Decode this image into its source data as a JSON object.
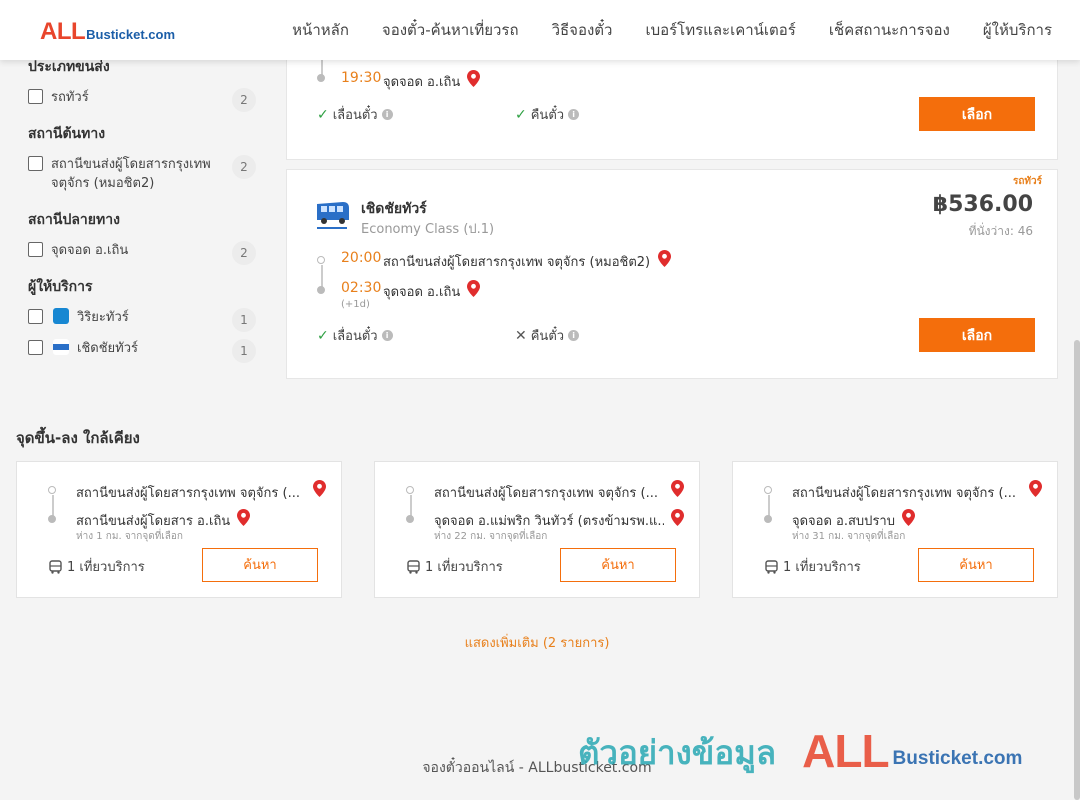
{
  "header": {
    "logo_all": "ALL",
    "logo_rest": "Busticket.com",
    "nav": [
      "หน้าหลัก",
      "จองตั๋ว-ค้นหาเที่ยวรถ",
      "วิธีจองตั๋ว",
      "เบอร์โทรและเคาน์เตอร์",
      "เช็คสถานะการจอง",
      "ผู้ให้บริการ"
    ]
  },
  "sidebar": {
    "vehicle_type": {
      "heading": "ประเภทขนส่ง",
      "items": [
        {
          "label": "รถทัวร์",
          "count": "2"
        }
      ]
    },
    "origin": {
      "heading": "สถานีต้นทาง",
      "items": [
        {
          "label": "สถานีขนส่งผู้โดยสารกรุงเทพ จตุจักร (หมอชิต2)",
          "count": "2"
        }
      ]
    },
    "destination": {
      "heading": "สถานีปลายทาง",
      "items": [
        {
          "label": "จุดจอด อ.เถิน",
          "count": "2"
        }
      ]
    },
    "operators": {
      "heading": "ผู้ให้บริการ",
      "items": [
        {
          "label": "วิริยะทัวร์",
          "count": "1"
        },
        {
          "label": "เชิดชัยทัวร์",
          "count": "1"
        }
      ]
    }
  },
  "trip1": {
    "arrive_time": "19:30",
    "arrive_stop": "จุดจอด อ.เถิน",
    "feature_change": "เลื่อนตั๋ว",
    "feature_refund": "คืนตั๋ว",
    "select_label": "เลือก"
  },
  "trip2": {
    "tag": "รถทัวร์",
    "operator": "เชิดชัยทัวร์",
    "class": "Economy Class (ป.1)",
    "price": "฿536.00",
    "seats": "ที่นั่งว่าง: 46",
    "depart_time": "20:00",
    "depart_stop": "สถานีขนส่งผู้โดยสารกรุงเทพ จตุจักร (หมอชิต2)",
    "arrive_time": "02:30",
    "arrive_stop": "จุดจอด อ.เถิน",
    "next_day": "(+1d)",
    "feature_change": "เลื่อนตั๋ว",
    "feature_refund": "คืนตั๋ว",
    "select_label": "เลือก"
  },
  "nearby": {
    "title": "จุดขึ้น-ลง ใกล้เคียง",
    "cards": [
      {
        "from": "สถานีขนส่งผู้โดยสารกรุงเทพ จตุจักร (...",
        "to": "สถานีขนส่งผู้โดยสาร อ.เถิน",
        "distance": "ห่าง 1 กม. จากจุดที่เลือก",
        "trips": "1 เที่ยวบริการ",
        "search_label": "ค้นหา"
      },
      {
        "from": "สถานีขนส่งผู้โดยสารกรุงเทพ จตุจักร (...",
        "to": "จุดจอด อ.แม่พริก วินทัวร์ (ตรงข้ามรพ.แ...",
        "distance": "ห่าง 22 กม. จากจุดที่เลือก",
        "trips": "1 เที่ยวบริการ",
        "search_label": "ค้นหา"
      },
      {
        "from": "สถานีขนส่งผู้โดยสารกรุงเทพ จตุจักร (...",
        "to": "จุดจอด อ.สบปราบ",
        "distance": "ห่าง 31 กม. จากจุดที่เลือก",
        "trips": "1 เที่ยวบริการ",
        "search_label": "ค้นหา"
      }
    ],
    "show_more": "แสดงเพิ่มเติม (2 รายการ)"
  },
  "footer": {
    "text": "จองตั๋วออนไลน์ - ALLbusticket.com"
  },
  "watermark": {
    "thai": "ตัวอย่างข้อมูล",
    "all": "ALL",
    "rest": "Busticket.com"
  },
  "colors": {
    "accent": "#f46e0c",
    "time": "#e8801c",
    "brand_red": "#e8452c",
    "brand_blue": "#1b5ea8"
  }
}
